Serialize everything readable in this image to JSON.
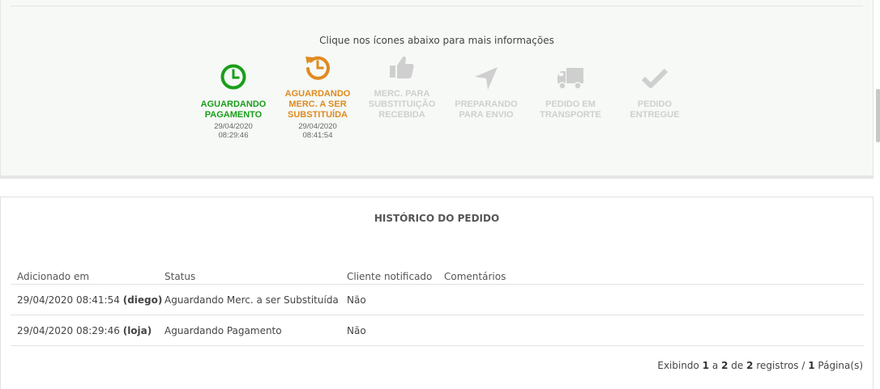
{
  "tracker": {
    "hint": "Clique nos ícones abaixo para mais informações",
    "colors": {
      "done": "#1a9e1a",
      "current": "#e08a1e",
      "pending": "#cfcfcf"
    },
    "steps": [
      {
        "label_lines": [
          "AGUARDANDO",
          "PAGAMENTO"
        ],
        "date": "29/04/2020",
        "time": "08:29:46",
        "state": "done",
        "icon": "clock-icon"
      },
      {
        "label_lines": [
          "AGUARDANDO",
          "MERC. A SER",
          "SUBSTITUÍDA"
        ],
        "date": "29/04/2020",
        "time": "08:41:54",
        "state": "current",
        "icon": "history-icon"
      },
      {
        "label_lines": [
          "MERC. PARA",
          "SUBSTITUIÇÃO",
          "RECEBIDA"
        ],
        "date": "",
        "time": "",
        "state": "pending",
        "icon": "thumbs-up-icon"
      },
      {
        "label_lines": [
          "PREPARANDO",
          "PARA ENVIO"
        ],
        "date": "",
        "time": "",
        "state": "pending",
        "icon": "location-arrow-icon"
      },
      {
        "label_lines": [
          "PEDIDO EM",
          "TRANSPORTE"
        ],
        "date": "",
        "time": "",
        "state": "pending",
        "icon": "truck-icon"
      },
      {
        "label_lines": [
          "PEDIDO",
          "ENTREGUE"
        ],
        "date": "",
        "time": "",
        "state": "pending",
        "icon": "check-icon"
      }
    ]
  },
  "history": {
    "title": "HISTÓRICO DO PEDIDO",
    "columns": [
      "Adicionado em",
      "Status",
      "Cliente notificado",
      "Comentários"
    ],
    "rows": [
      {
        "added": "29/04/2020 08:41:54",
        "user": "(diego)",
        "status": "Aguardando Merc. a ser Substituída",
        "notified": "Não",
        "comments": ""
      },
      {
        "added": "29/04/2020 08:29:46",
        "user": "(loja)",
        "status": "Aguardando Pagamento",
        "notified": "Não",
        "comments": ""
      }
    ],
    "pagination": {
      "prefix": "Exibindo",
      "from": "1",
      "sep1": "a",
      "to": "2",
      "sep2": "de",
      "total": "2",
      "registros": "registros /",
      "pages": "1",
      "pages_label": "Página(s)"
    }
  }
}
